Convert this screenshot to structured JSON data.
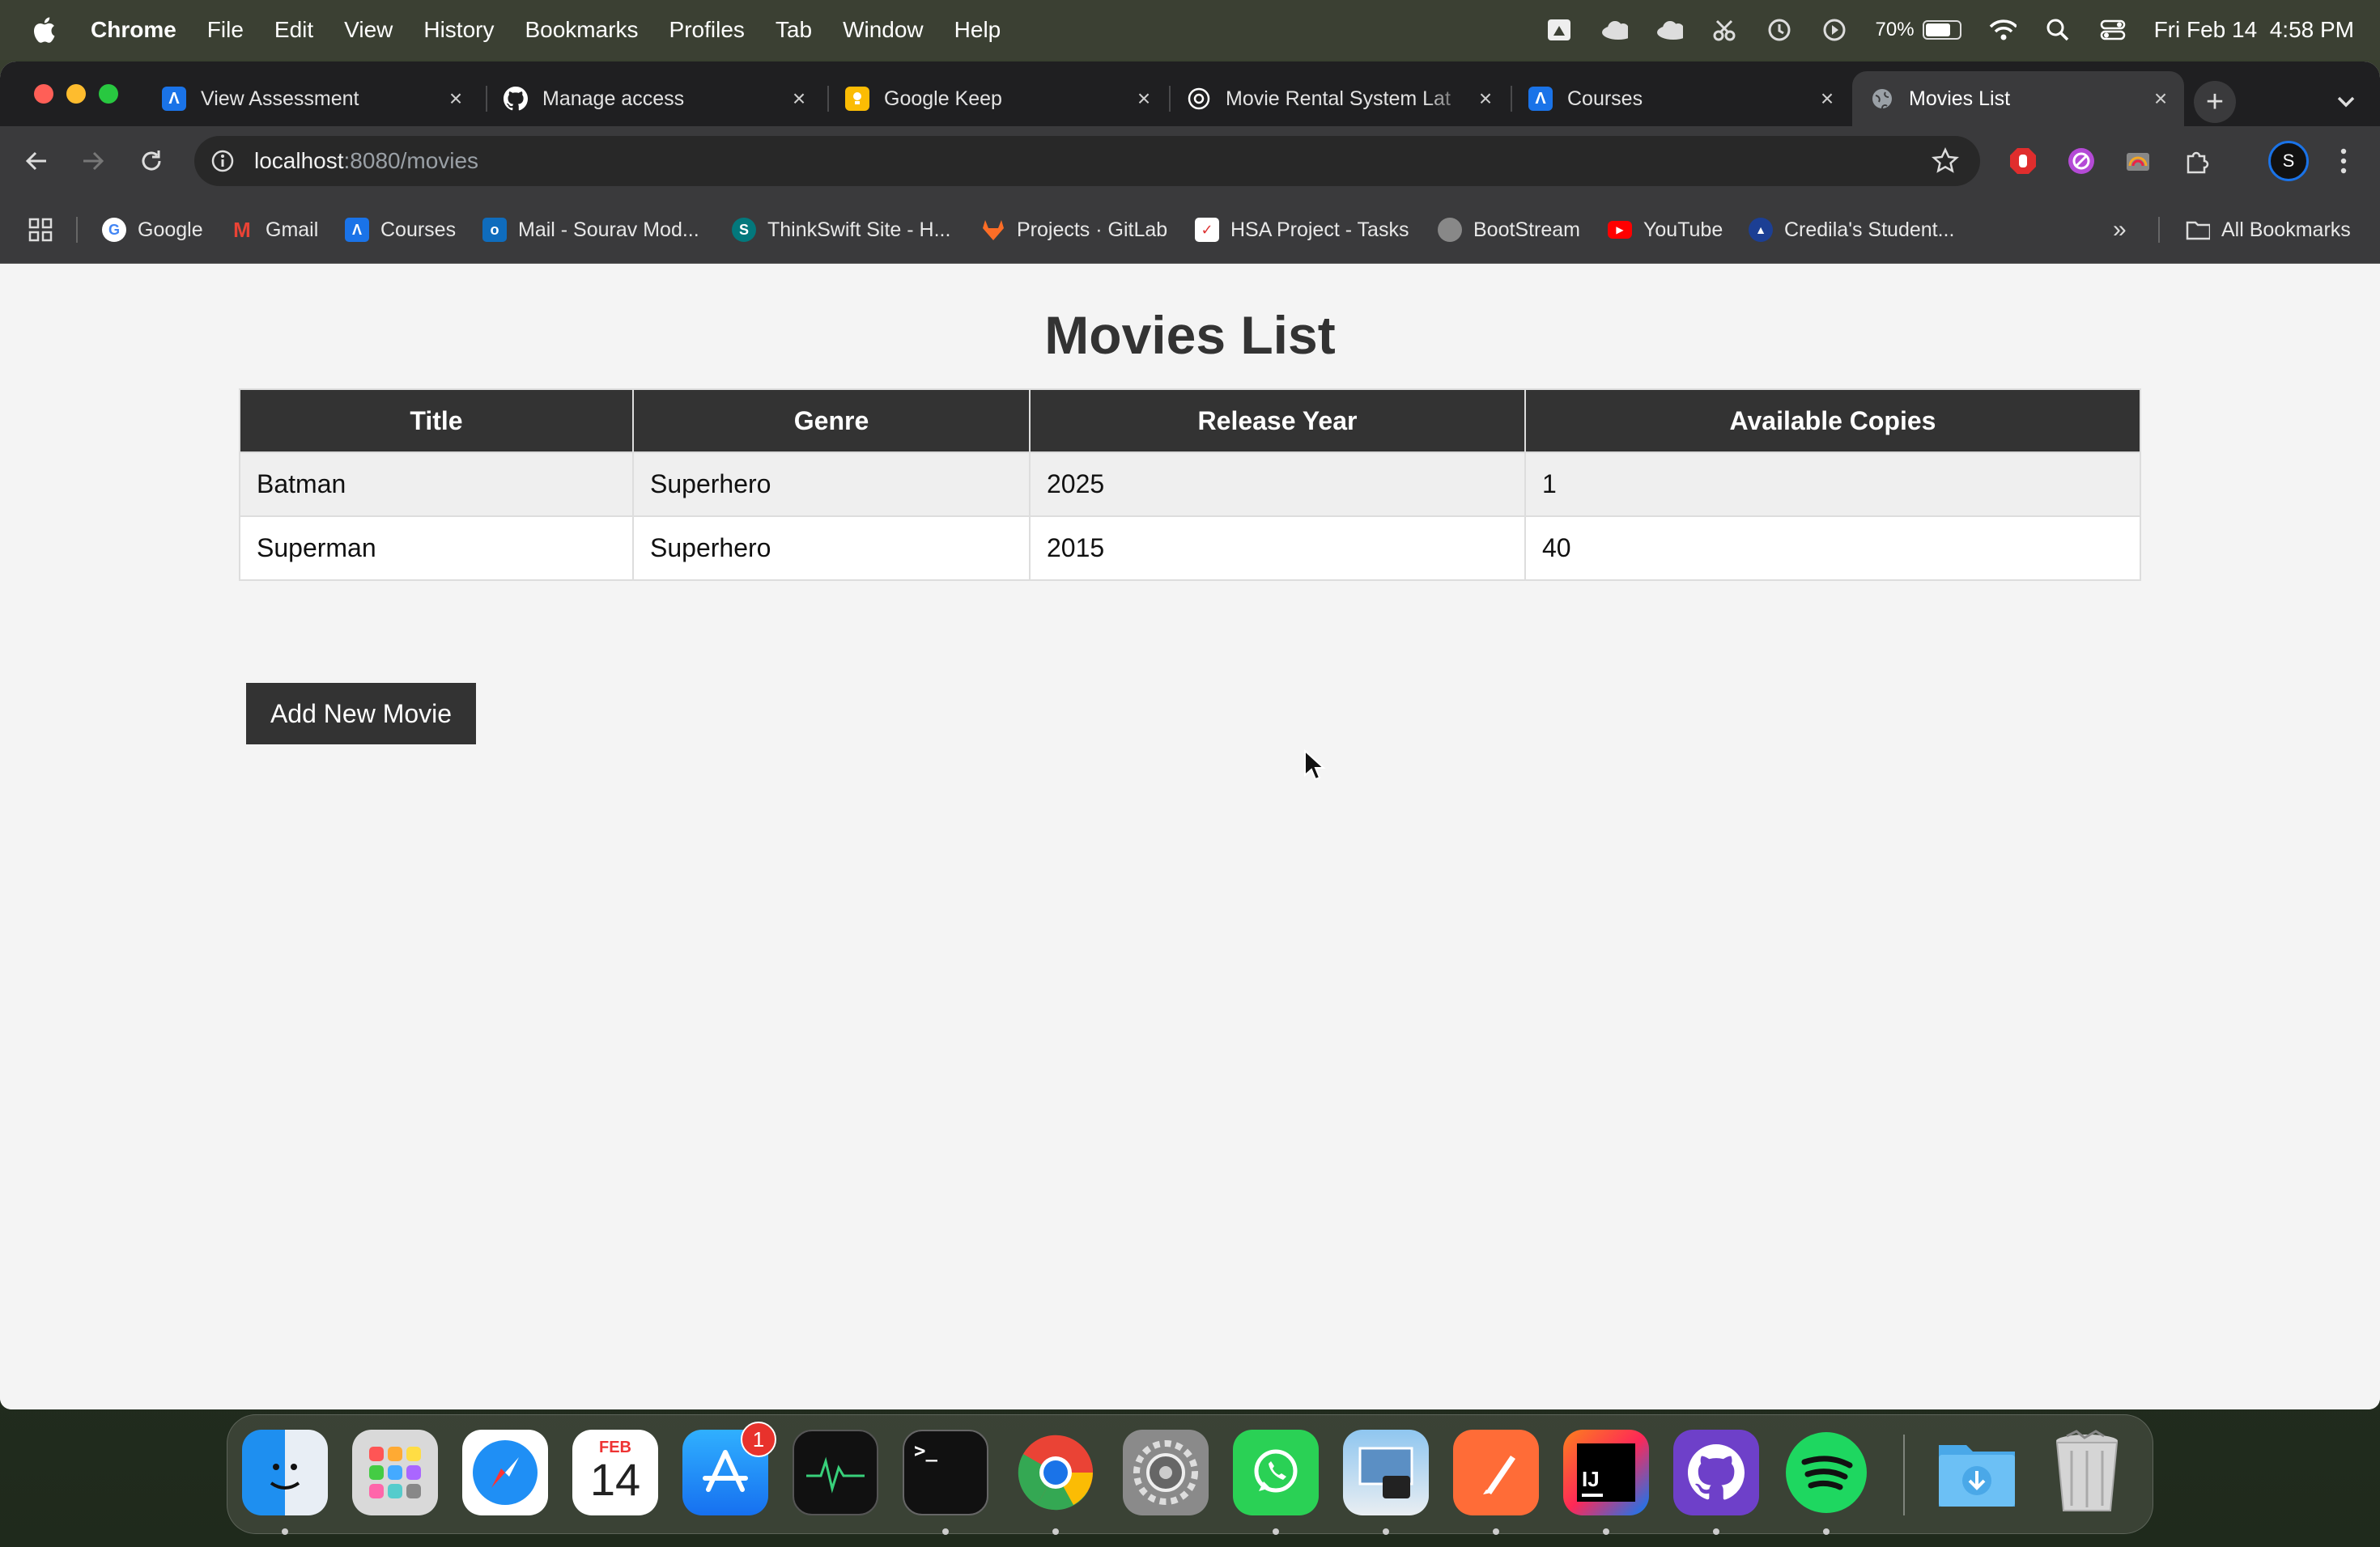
{
  "menubar": {
    "app_name": "Chrome",
    "items": [
      "File",
      "Edit",
      "View",
      "History",
      "Bookmarks",
      "Profiles",
      "Tab",
      "Window",
      "Help"
    ],
    "battery_percent": "70%",
    "datetime": "Fri Feb 14  4:58 PM"
  },
  "tabs": [
    {
      "title": "View Assessment",
      "icon": "astra-icon",
      "color": "#1a73e8"
    },
    {
      "title": "Manage access",
      "icon": "github-icon",
      "color": "#ffffff"
    },
    {
      "title": "Google Keep",
      "icon": "keep-icon",
      "color": "#fbbc04"
    },
    {
      "title": "Movie Rental System Lat",
      "icon": "openai-icon",
      "color": "#ffffff"
    },
    {
      "title": "Courses",
      "icon": "astra-icon",
      "color": "#1a73e8"
    },
    {
      "title": "Movies List",
      "icon": "globe-icon",
      "color": "#9aa0a6"
    }
  ],
  "address_bar": {
    "host": "localhost",
    "path": ":8080/movies"
  },
  "bookmarks": [
    {
      "label": "Google"
    },
    {
      "label": "Gmail"
    },
    {
      "label": "Courses"
    },
    {
      "label": "Mail - Sourav Mod..."
    },
    {
      "label": "ThinkSwift Site - H..."
    },
    {
      "label": "Projects · GitLab"
    },
    {
      "label": "HSA Project - Tasks"
    },
    {
      "label": "BootStream"
    },
    {
      "label": "YouTube"
    },
    {
      "label": "Credila's Student..."
    }
  ],
  "all_bookmarks_label": "All Bookmarks",
  "page": {
    "title": "Movies List",
    "columns": [
      "Title",
      "Genre",
      "Release Year",
      "Available Copies"
    ],
    "rows": [
      [
        "Batman",
        "Superhero",
        "2025",
        "1"
      ],
      [
        "Superman",
        "Superhero",
        "2015",
        "40"
      ]
    ],
    "add_button": "Add New Movie"
  },
  "dock": {
    "calendar_month": "FEB",
    "calendar_day": "14",
    "app_store_badge": "1",
    "intellij_label": "IJ",
    "terminal_prompt": ">_"
  }
}
